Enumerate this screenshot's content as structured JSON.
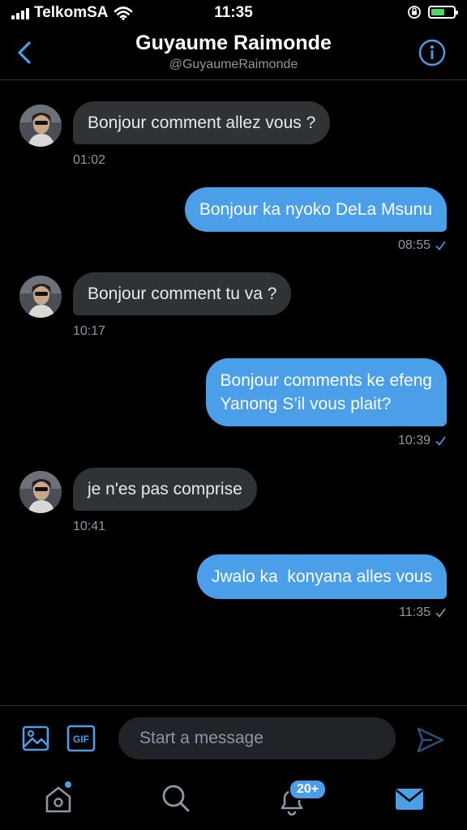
{
  "status_bar": {
    "carrier": "TelkomSA",
    "time": "11:35"
  },
  "header": {
    "name": "Guyaume Raimonde",
    "handle": "@GuyaumeRaimonde"
  },
  "messages": [
    {
      "direction": "in",
      "text": "Bonjour comment allez vous ?",
      "time": "01:02"
    },
    {
      "direction": "out",
      "text": "Bonjour ka nyoko DeLa Msunu",
      "time": "08:55"
    },
    {
      "direction": "in",
      "text": "Bonjour comment tu va ?",
      "time": "10:17"
    },
    {
      "direction": "out",
      "text_line1": "Bonjour comments ke efeng",
      "text_line2": "Yanong S’il vous plait?",
      "time": "10:39"
    },
    {
      "direction": "in",
      "text": "je n'es pas comprise",
      "time": "10:41"
    },
    {
      "direction": "out",
      "text": "Jwalo ka  konyana alles vous",
      "time": "11:35"
    }
  ],
  "composer": {
    "placeholder": "Start a message",
    "gif_label": "GIF"
  },
  "tabbar": {
    "notifications_badge": "20+"
  },
  "colors": {
    "accent": "#4a9fe8",
    "incoming_bubble": "#2f3336",
    "background": "#000000",
    "muted_text": "#8b98a5"
  }
}
